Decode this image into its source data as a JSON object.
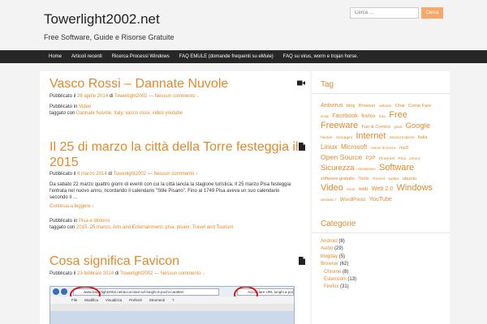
{
  "site": {
    "title": "Towerlight2002.net",
    "tagline": "Free Software, Guide e Risorse Gratuite"
  },
  "search": {
    "placeholder": "Cerca …",
    "button": "Cerca"
  },
  "nav": {
    "items": [
      "Home",
      "Articoli recenti",
      "Ricerca Processi Windows",
      "FAQ EMULE (domande frequenti su eMule)",
      "FAQ su virus, worm e trojan horse."
    ]
  },
  "posts": [
    {
      "title": "Vasco Rossi – Dannate Nuvole",
      "icon": "video-icon",
      "meta_prefix": "Pubblicato il",
      "date": "26 aprile 2014",
      "by": "di",
      "author": "Towerlight2002",
      "comments": "Nessun commento ↓",
      "cat_prefix": "Pubblicato in",
      "category": "Video",
      "tags_prefix": "taggato con",
      "tags": "Dannate Nuvole, Italy, vasco rossi, video youtube"
    },
    {
      "title_line1": "Il 25 di marzo la città della Torre festeggia il",
      "title_line2": "2015",
      "icon": "document-icon",
      "meta_prefix": "Pubblicato il",
      "date": "8 marzo 2014",
      "by": "di",
      "author": "Towerlight2002",
      "comments": "Nessun commento ↓",
      "excerpt_1": "Da sabato 22 marzo quattro giorni di eventi con cui la città lancia la stagione turistica. Il 25 marzo Pisa festeggia",
      "excerpt_2": "l'entrata nel nuovo anno, ricordando il calendario \"Stile Pisano\". Fino al 1749 Pisa aveva un suo calendario",
      "excerpt_3": "secondo il …",
      "more": "Continua a leggere ›",
      "cat_prefix": "Pubblicato in",
      "category": "Pisa e dintorni",
      "tags_prefix": "taggato con",
      "tags": "2015, 25 marzo, Arts and Entertainment, pisa, pisani, Travel and Tourism"
    },
    {
      "title": "Cosa significa Favicon",
      "icon": "document-icon",
      "meta_prefix": "Pubblicato il",
      "date": "23 febbraio 2014",
      "by": "di",
      "author": "Towerlight2002",
      "comments": "Nessun commento ↓",
      "shot_url": "www.towerlight2002.net/accorciare-url-lunghi-a-pochi-caratteri",
      "shot_tab": "Accorciare URL lunghi a poc",
      "shot_menu": [
        "File",
        "Modifica",
        "Visualizza",
        "Preferiti",
        "Strumenti",
        "?"
      ]
    }
  ],
  "sidebar": {
    "tag_title": "Tag",
    "tags": [
      {
        "t": "Antivirus",
        "s": 8
      },
      {
        "t": "blog",
        "s": 6
      },
      {
        "t": "Browser",
        "s": 6
      },
      {
        "t": "cellulare",
        "s": 4
      },
      {
        "t": "Chat",
        "s": 6
      },
      {
        "t": "Come Fare",
        "s": 6
      },
      {
        "t": "email",
        "s": 4
      },
      {
        "t": "Facebook",
        "s": 8
      },
      {
        "t": "firefox",
        "s": 7
      },
      {
        "t": "foto",
        "s": 5
      },
      {
        "t": "Free",
        "s": 13
      },
      {
        "t": "Freeware",
        "s": 13
      },
      {
        "t": "Fun & Comics",
        "s": 6
      },
      {
        "t": "gmail",
        "s": 4
      },
      {
        "t": "Google",
        "s": 11
      },
      {
        "t": "hacker",
        "s": 5
      },
      {
        "t": "Immagini",
        "s": 5
      },
      {
        "t": "Internet",
        "s": 13
      },
      {
        "t": "Internet Explorer",
        "s": 4
      },
      {
        "t": "italia",
        "s": 6
      },
      {
        "t": "Linux",
        "s": 10
      },
      {
        "t": "Microsoft",
        "s": 9
      },
      {
        "t": "motore di ricerca",
        "s": 4
      },
      {
        "t": "mp3",
        "s": 6
      },
      {
        "t": "Open Source",
        "s": 10
      },
      {
        "t": "P2P",
        "s": 7
      },
      {
        "t": "Pinterest",
        "s": 5
      },
      {
        "t": "Pisa",
        "s": 5
      },
      {
        "t": "privacy",
        "s": 4
      },
      {
        "t": "Sicurezza",
        "s": 11
      },
      {
        "t": "smartphone",
        "s": 4
      },
      {
        "t": "Software",
        "s": 13
      },
      {
        "t": "software gratuito",
        "s": 6
      },
      {
        "t": "Tools",
        "s": 6
      },
      {
        "t": "Torrent",
        "s": 5
      },
      {
        "t": "twitter",
        "s": 5
      },
      {
        "t": "ubuntu",
        "s": 6
      },
      {
        "t": "Video",
        "s": 13
      },
      {
        "t": "virus",
        "s": 5
      },
      {
        "t": "web",
        "s": 7
      },
      {
        "t": "Web 2.0",
        "s": 8
      },
      {
        "t": "Windows",
        "s": 13
      },
      {
        "t": "windows 7",
        "s": 4
      },
      {
        "t": "WordPress",
        "s": 7
      },
      {
        "t": "YouTube",
        "s": 8
      }
    ],
    "cat_title": "Categorie",
    "cats": [
      {
        "name": "Android",
        "count": "(8)",
        "sub": false
      },
      {
        "name": "Audio",
        "count": "(29)",
        "sub": false
      },
      {
        "name": "blogday",
        "count": "(5)",
        "sub": false
      },
      {
        "name": "Browser",
        "count": "(62)",
        "sub": false
      },
      {
        "name": "Chrome",
        "count": "(8)",
        "sub": true
      },
      {
        "name": "Estensioni",
        "count": "(13)",
        "sub": true
      },
      {
        "name": "Firefox",
        "count": "(31)",
        "sub": true
      }
    ]
  }
}
